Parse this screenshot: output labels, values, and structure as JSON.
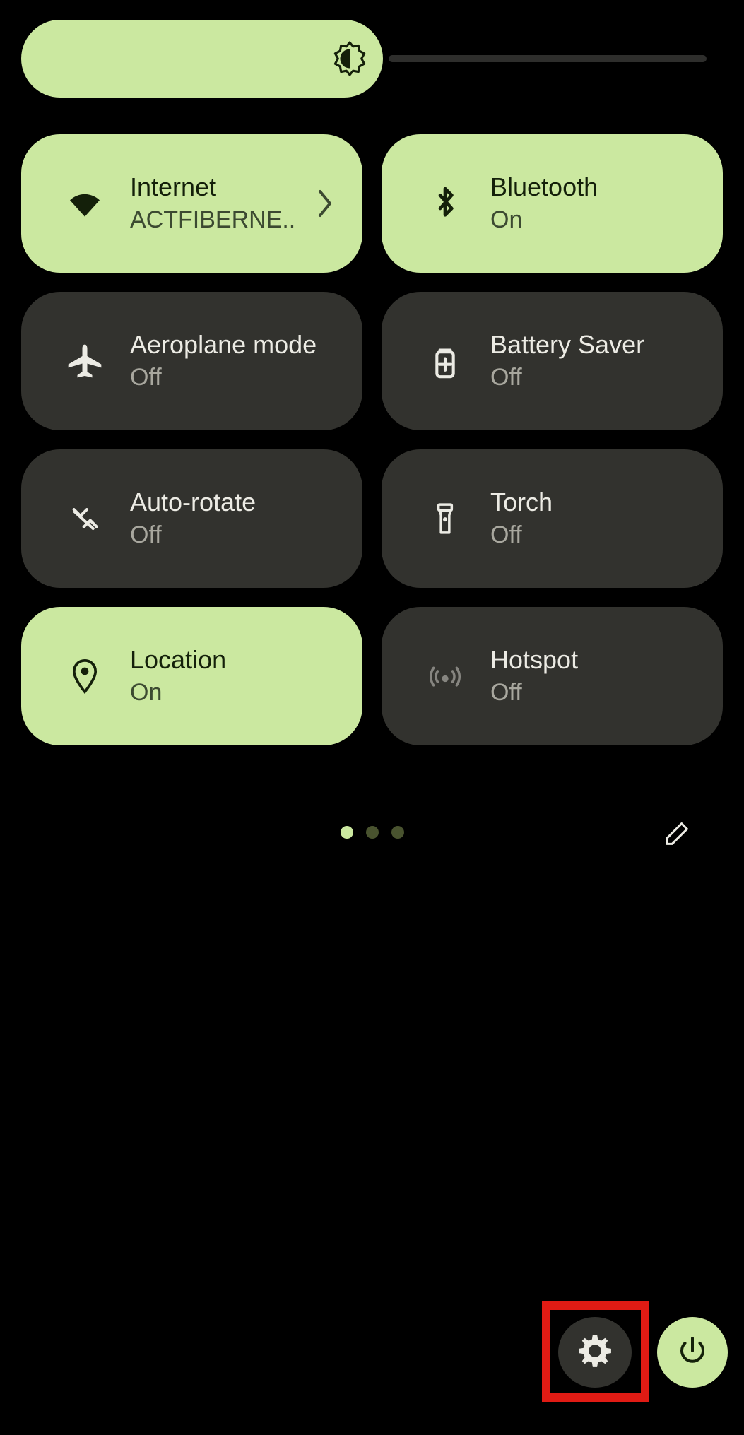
{
  "theme": {
    "background": "#000000",
    "tile_active_bg": "#cbe8a0",
    "tile_inactive_bg": "#32322e",
    "tile_active_text": "#14200a",
    "tile_inactive_text": "#ecebe4",
    "tile_inactive_subtext": "#a8a79e",
    "highlight_box": "#e01b14",
    "dot_active": "#cbe8a0",
    "dot_inactive": "#49532f"
  },
  "brightness": {
    "name": "brightness-slider",
    "icon": "brightness-icon",
    "value_percent": 52
  },
  "tiles": [
    {
      "title": "Internet",
      "subtitle": "ACTFIBERNE..",
      "state": "on",
      "icon": "wifi-icon",
      "has_chevron": true
    },
    {
      "title": "Bluetooth",
      "subtitle": "On",
      "state": "on",
      "icon": "bluetooth-icon",
      "has_chevron": false
    },
    {
      "title": "Aeroplane mode",
      "subtitle": "Off",
      "state": "off",
      "icon": "airplane-icon",
      "has_chevron": false
    },
    {
      "title": "Battery Saver",
      "subtitle": "Off",
      "state": "off",
      "icon": "battery-saver-icon",
      "has_chevron": false
    },
    {
      "title": "Auto-rotate",
      "subtitle": "Off",
      "state": "off",
      "icon": "auto-rotate-icon",
      "has_chevron": false
    },
    {
      "title": "Torch",
      "subtitle": "Off",
      "state": "off",
      "icon": "flashlight-icon",
      "has_chevron": false
    },
    {
      "title": "Location",
      "subtitle": "On",
      "state": "on",
      "icon": "location-pin-icon",
      "has_chevron": false
    },
    {
      "title": "Hotspot",
      "subtitle": "Off",
      "state": "off",
      "icon": "hotspot-icon",
      "has_chevron": false,
      "dimmed_icon": true
    }
  ],
  "pager": {
    "name": "page-indicator",
    "total_pages": 3,
    "current_page": 1
  },
  "edit": {
    "name": "edit-tiles-button",
    "icon": "pencil-icon"
  },
  "bottom_bar": {
    "settings": {
      "name": "settings-button",
      "icon": "gear-icon",
      "highlighted": true
    },
    "power": {
      "name": "power-button",
      "icon": "power-icon"
    }
  }
}
